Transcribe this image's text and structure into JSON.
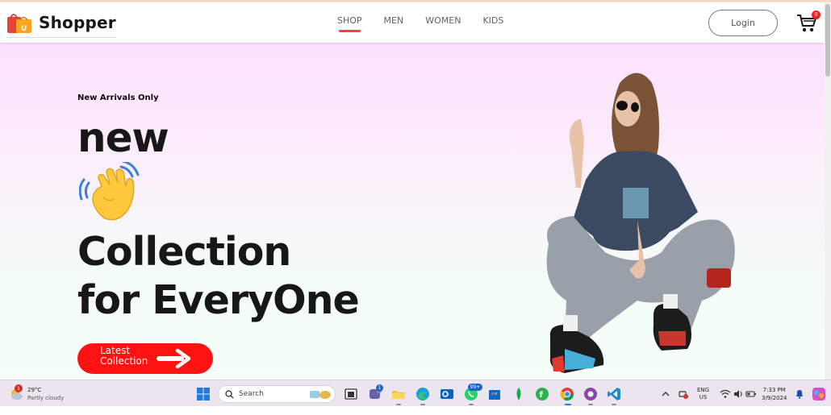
{
  "navbar": {
    "brand": "Shopper",
    "menu": [
      {
        "label": "SHOP",
        "active": true
      },
      {
        "label": "MEN",
        "active": false
      },
      {
        "label": "WOMEN",
        "active": false
      },
      {
        "label": "KIDS",
        "active": false
      }
    ],
    "login_label": "Login",
    "cart_count": "0",
    "accent_color": "#ff4141"
  },
  "hero": {
    "kicker": "New Arrivals Only",
    "headline_word": "new",
    "hand_icon": "waving-hand-icon",
    "line1": "Collection",
    "line2": "for EveryOne",
    "button_label": "Latest Collection",
    "button_color": "#ff1212"
  },
  "taskbar": {
    "weather_temp": "29°C",
    "weather_desc": "Partly cloudy",
    "weather_badge": "1",
    "search_placeholder": "Search",
    "teams_badge": "1",
    "whatsapp_badge": "99+",
    "lang_primary": "ENG",
    "lang_secondary": "US",
    "time": "7:33 PM",
    "date": "3/9/2024"
  }
}
